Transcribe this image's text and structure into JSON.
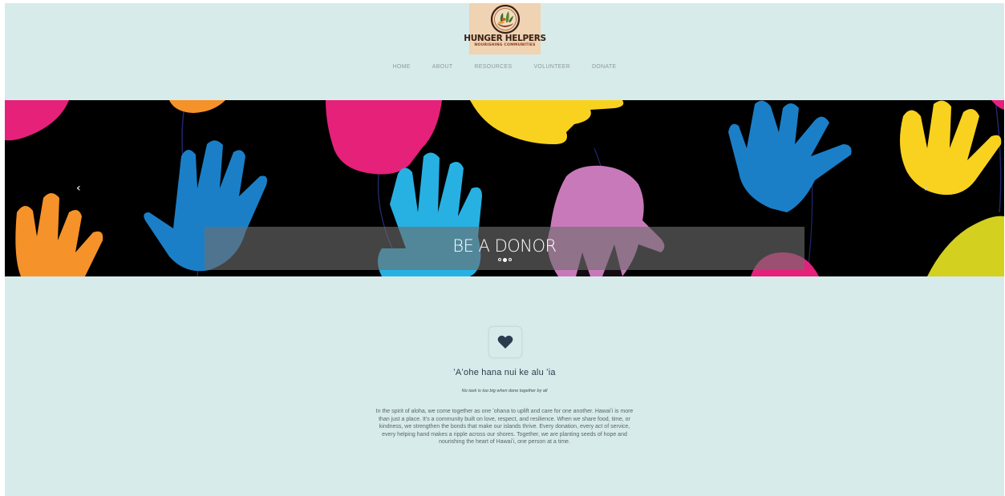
{
  "brand": {
    "name": "HUNGER HELPERS",
    "tagline": "NOURISHING COMMUNITIES",
    "colors": {
      "page_bg": "#d7ebea",
      "logo_bg": "#efd3b3",
      "logo_text": "#3a2216"
    }
  },
  "nav": {
    "items": [
      {
        "label": "HOME"
      },
      {
        "label": "ABOUT"
      },
      {
        "label": "RESOURCES"
      },
      {
        "label": "VOLUNTEER"
      },
      {
        "label": "DONATE"
      }
    ]
  },
  "hero": {
    "caption": "BE A DONOR",
    "prev_icon": "chevron-left-icon",
    "next_icon": "chevron-right-icon",
    "slides": {
      "count": 3,
      "active_index": 1
    }
  },
  "content": {
    "icon": "heart-icon",
    "motto": "ʻAʻohe hana nui ke alu ʻia",
    "tagline": "No task is too big when done together by all",
    "body": "In the spirit of aloha, we come together as one ʻohana to uplift and care for one another. Hawaiʻi is more than just a place. It's a community built on love, respect, and resilience. When we share food, time, or kindness, we strengthen the bonds that make our islands thrive. Every donation, every act of service, every helping hand makes a ripple across our shores. Together, we are planting seeds of hope and nourishing the heart of Hawaiʻi, one person at a time."
  }
}
